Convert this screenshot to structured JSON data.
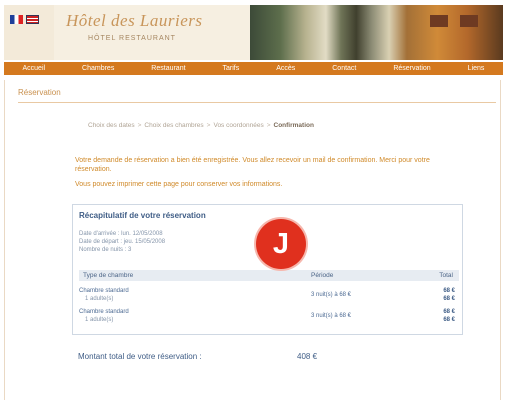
{
  "header": {
    "languages": [
      "FR",
      "EN"
    ],
    "hotel_name": "Hôtel des Lauriers",
    "hotel_subtitle": "HÔTEL RESTAURANT"
  },
  "nav": {
    "items": [
      "Accueil",
      "Chambres",
      "Restaurant",
      "Tarifs",
      "Accès",
      "Contact",
      "Réservation",
      "Liens"
    ]
  },
  "page": {
    "section_title": "Réservation",
    "breadcrumb": [
      "Choix des dates",
      "Choix des chambres",
      "Vos coordonnées",
      "Confirmation"
    ],
    "notice_1": "Votre demande de réservation a bien été enregistrée. Vous allez recevoir un mail de confirmation. Merci pour votre réservation.",
    "notice_2": "Vous pouvez imprimer cette page pour conserver vos informations."
  },
  "recap": {
    "title": "Récapitulatif de votre réservation",
    "lines": [
      "Date d'arrivée : lun. 12/05/2008",
      "Date de départ : jeu. 15/05/2008",
      "Nombre de nuits : 3"
    ],
    "columns": {
      "room": "Type de chambre",
      "period": "Période",
      "total": "Total"
    },
    "rows": [
      {
        "name": "Chambre standard",
        "detail": "1 adulte(s)",
        "period": "3 nuit(s) à 68 €",
        "price": "68 €",
        "price2": "68 €"
      },
      {
        "name": "Chambre standard",
        "detail": "1 adulte(s)",
        "period": "3 nuit(s) à 68 €",
        "price": "68 €",
        "price2": "68 €"
      }
    ],
    "badge_letter": "J"
  },
  "total": {
    "label": "Montant total de votre réservation :",
    "value": "408 €"
  }
}
